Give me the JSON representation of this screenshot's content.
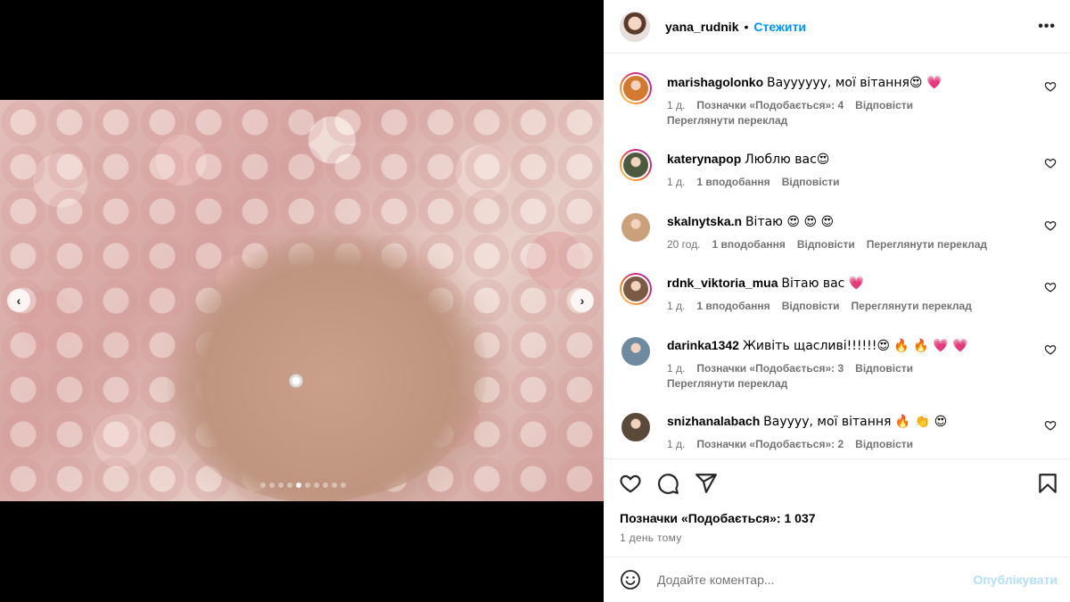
{
  "post": {
    "author": "yana_rudnik",
    "separator": "•",
    "follow_label": "Стежити",
    "more_label": "•••",
    "carousel": {
      "prev": "‹",
      "next": "›",
      "slide_count": 10,
      "active_index": 4
    }
  },
  "comments": [
    {
      "user": "marishagolonko",
      "text": "Вауууууу, мої вітання😍 💗",
      "time": "1 д.",
      "likes": "Позначки «Подобається»: 4",
      "reply": "Відповісти",
      "translate": "Переглянути переклад",
      "avatar": "#d2782f",
      "story_ring": true
    },
    {
      "user": "katerynapop",
      "text": "Люблю вас😍",
      "time": "1 д.",
      "likes": "1 вподобання",
      "reply": "Відповісти",
      "translate": "",
      "avatar": "#4b5a3e",
      "story_ring": true
    },
    {
      "user": "skalnytska.n",
      "text": "Вітаю 😍 😍 😍",
      "time": "20 год.",
      "likes": "1 вподобання",
      "reply": "Відповісти",
      "translate": "Переглянути переклад",
      "avatar": "#caa17a",
      "story_ring": false
    },
    {
      "user": "rdnk_viktoria_mua",
      "text": "Вітаю вас 💗",
      "time": "1 д.",
      "likes": "1 вподобання",
      "reply": "Відповісти",
      "translate": "Переглянути переклад",
      "avatar": "#7a5a44",
      "story_ring": true
    },
    {
      "user": "darinka1342",
      "text": "Живіть щасливі!!!!!!😍 🔥 🔥 💗 💗",
      "time": "1 д.",
      "likes": "Позначки «Подобається»: 3",
      "reply": "Відповісти",
      "translate": "Переглянути переклад",
      "avatar": "#6f8aa0",
      "story_ring": false
    },
    {
      "user": "snizhanalabach",
      "text": "Вауууу, мої вітання 🔥 👏 😍",
      "time": "1 д.",
      "likes": "Позначки «Подобається»: 2",
      "reply": "Відповісти",
      "translate": "",
      "avatar": "#5b4a3a",
      "story_ring": false
    }
  ],
  "actions": {
    "likes_text": "Позначки «Подобається»: 1 037",
    "time_text": "1 день тому"
  },
  "composer": {
    "placeholder": "Додайте коментар...",
    "publish_label": "Опублікувати"
  },
  "colors": {
    "link": "#0095f6",
    "muted": "#737373",
    "publish_disabled": "#b2dffc"
  }
}
